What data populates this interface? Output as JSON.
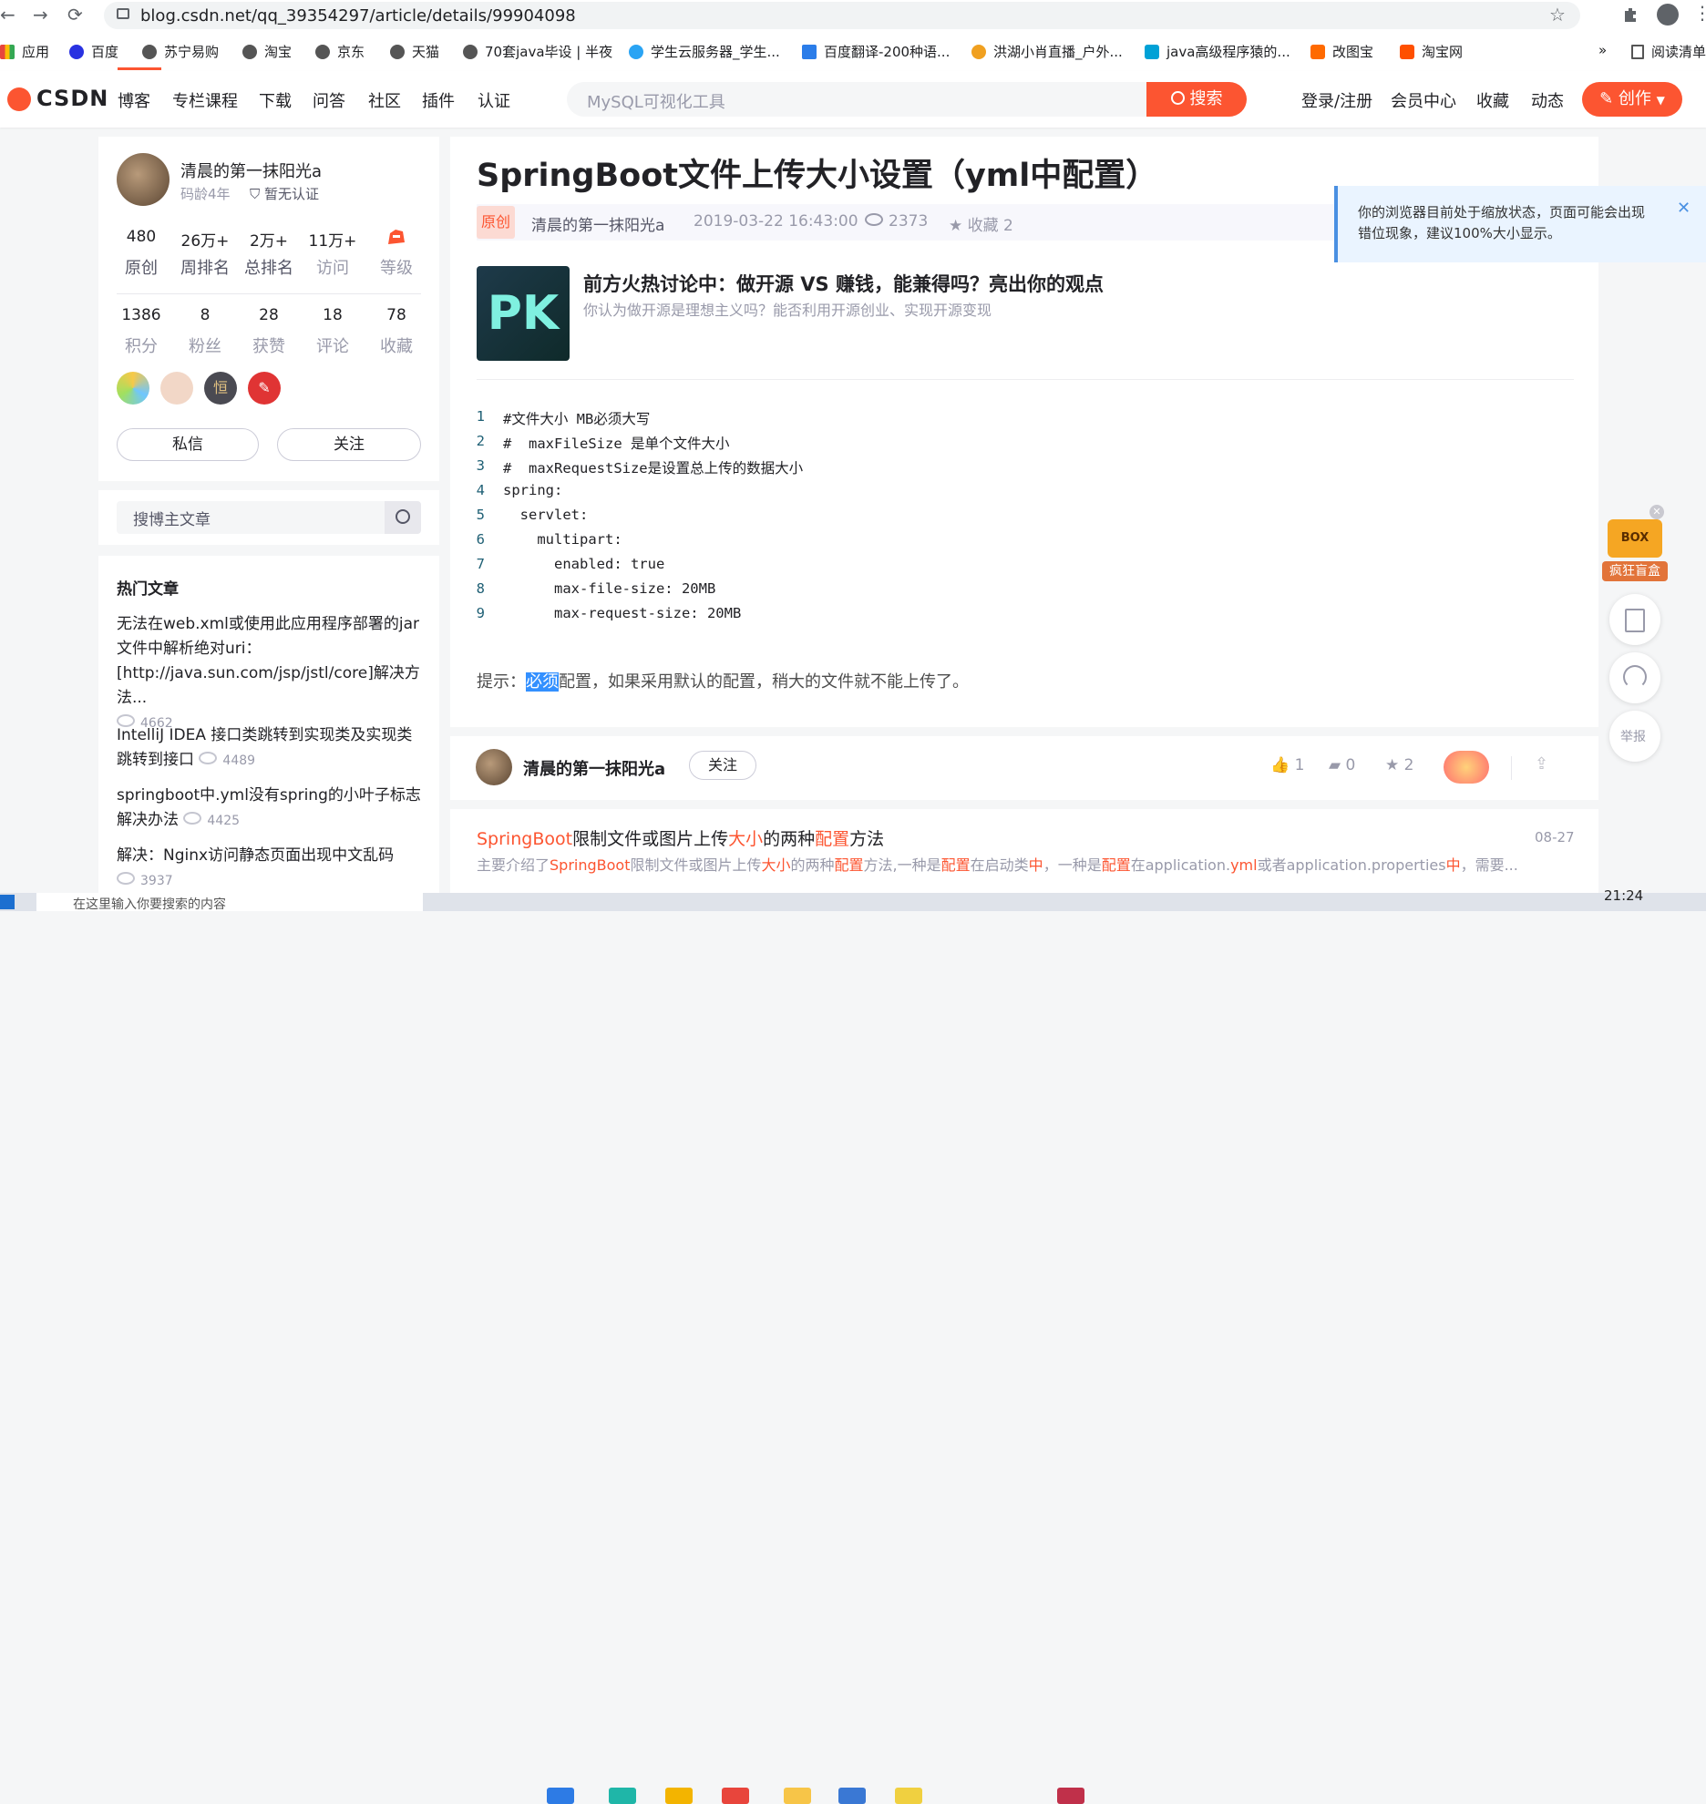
{
  "browser": {
    "url": "blog.csdn.net/qq_39354297/article/details/99904098",
    "bookmarks": [
      {
        "label": "应用",
        "color": "#e8453c"
      },
      {
        "label": "百度",
        "color": "#2932e1"
      },
      {
        "label": "苏宁易购",
        "color": "#555"
      },
      {
        "label": "淘宝",
        "color": "#555"
      },
      {
        "label": "京东",
        "color": "#555"
      },
      {
        "label": "天猫",
        "color": "#555"
      },
      {
        "label": "70套java毕设 | 半夜",
        "color": "#555"
      },
      {
        "label": "学生云服务器_学生...",
        "color": "#2aa4f4"
      },
      {
        "label": "百度翻译-200种语...",
        "color": "#2b7de9"
      },
      {
        "label": "洪湖小肖直播_户外...",
        "color": "#f0a020"
      },
      {
        "label": "java高级程序猿的...",
        "color": "#00a1d6"
      },
      {
        "label": "改图宝",
        "color": "#ff6a00"
      },
      {
        "label": "淘宝网",
        "color": "#ff5000"
      }
    ],
    "more_bookmarks": "»",
    "reading_list": "阅读清单"
  },
  "header": {
    "logo": "CSDN",
    "nav": [
      "博客",
      "专栏课程",
      "下载",
      "问答",
      "社区",
      "插件",
      "认证"
    ],
    "search_placeholder": "MySQL可视化工具",
    "search_button": "搜索",
    "right_links": [
      "登录/注册",
      "会员中心",
      "收藏",
      "动态"
    ],
    "create_button": "创作",
    "accent": "#fc5531"
  },
  "profile": {
    "name": "清晨的第一抹阳光a",
    "code_age": "码龄4年",
    "cert": "暂无认证",
    "stats_row1": [
      {
        "value": "480",
        "label": "原创"
      },
      {
        "value": "26万+",
        "label": "周排名"
      },
      {
        "value": "2万+",
        "label": "总排名"
      },
      {
        "value": "11万+",
        "label": "访问"
      },
      {
        "value": "",
        "label": "等级"
      }
    ],
    "stats_row2": [
      {
        "value": "1386",
        "label": "积分"
      },
      {
        "value": "8",
        "label": "粉丝"
      },
      {
        "value": "28",
        "label": "获赞"
      },
      {
        "value": "18",
        "label": "评论"
      },
      {
        "value": "78",
        "label": "收藏"
      }
    ],
    "message_button": "私信",
    "follow_button": "关注"
  },
  "blog_search": {
    "placeholder": "搜博主文章"
  },
  "hot": {
    "title": "热门文章",
    "items": [
      {
        "title": "无法在web.xml或使用此应用程序部署的jar文件中解析绝对uri：[http://java.sun.com/jsp/jstl/core]解决方法...",
        "views": "4662"
      },
      {
        "title": "IntelliJ IDEA 接口类跳转到实现类及实现类跳转到接口",
        "views": "4489"
      },
      {
        "title": "springboot中.yml没有spring的小叶子标志解决办法",
        "views": "4425"
      },
      {
        "title": "解决：Nginx访问静态页面出现中文乱码",
        "views": "3937"
      }
    ]
  },
  "article": {
    "title": "SpringBoot文件上传大小设置（yml中配置）",
    "original_tag": "原创",
    "author": "清晨的第一抹阳光a",
    "date": "2019-03-22 16:43:00",
    "views": "2373",
    "favorites": "收藏 2",
    "promo_title": "前方火热讨论中：做开源 VS 赚钱，能兼得吗？亮出你的观点",
    "promo_sub": "你认为做开源是理想主义吗？能否利用开源创业、实现开源变现",
    "promo_badge": "PK",
    "code": [
      {
        "n": "1",
        "text": "#文件大小 MB必须大写"
      },
      {
        "n": "2",
        "text": "#  maxFileSize 是单个文件大小"
      },
      {
        "n": "3",
        "text": "#  maxRequestSize是设置总上传的数据大小"
      },
      {
        "n": "4",
        "text": "spring:"
      },
      {
        "n": "5",
        "text": "  servlet:"
      },
      {
        "n": "6",
        "text": "    multipart:"
      },
      {
        "n": "7",
        "text": "      enabled: true"
      },
      {
        "n": "8",
        "text": "      max-file-size: 20MB"
      },
      {
        "n": "9",
        "text": "      max-request-size: 20MB"
      }
    ],
    "tip_prefix": "提示：",
    "tip_selected": "必须",
    "tip_rest": "配置，如果采用默认的配置，稍大的文件就不能上传了。"
  },
  "author_bar": {
    "name": "清晨的第一抹阳光a",
    "follow": "关注",
    "likes": "1",
    "comments": "0",
    "stars": "2"
  },
  "recommend": {
    "title_parts": [
      "SpringBoot",
      "限制文件或图片上传",
      "大小",
      "的两种",
      "配置",
      "方法"
    ],
    "date": "08-27",
    "desc_parts": [
      "主要介绍了",
      "SpringBoot",
      "限制文件或图片上传",
      "大小",
      "的两种",
      "配置",
      "方法,一种是",
      "配置",
      "在启动类",
      "中",
      "，一种是",
      "配置",
      "在application.",
      "yml",
      "或者application.properties",
      "中",
      "，需要..."
    ]
  },
  "notice": {
    "text": "你的浏览器目前处于缩放状态，页面可能会出现错位现象，建议100%大小显示。"
  },
  "float": {
    "blindbox": "疯狂盲盒",
    "box_label": "BOX",
    "report": "举报"
  },
  "taskbar": {
    "search_hint": "在这里输入你要搜索的内容",
    "time": "21:24"
  }
}
